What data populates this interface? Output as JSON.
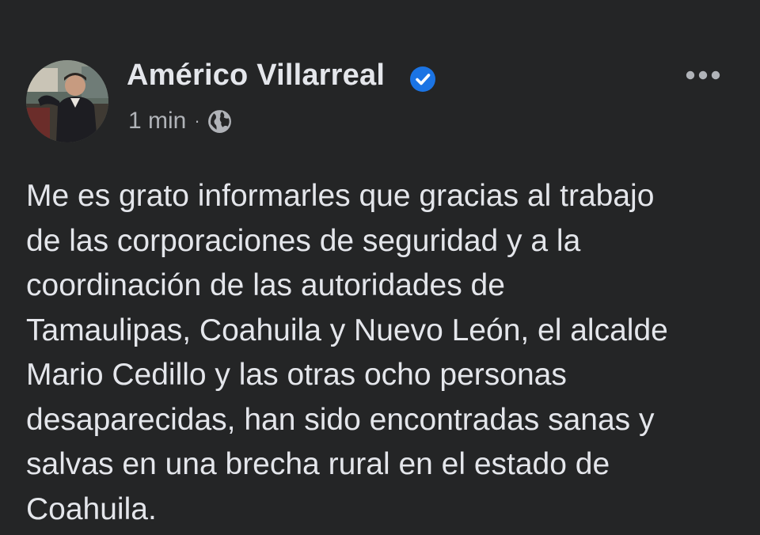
{
  "post": {
    "author": {
      "name": "Américo Villarreal",
      "verified": true,
      "avatar_icon": "person-portrait"
    },
    "timestamp": "1 min",
    "separator": "·",
    "audience_icon": "globe-icon",
    "menu_icon": "more-options-icon",
    "text_lines": [
      "Me es grato informarles que gracias al trabajo",
      "de las corporaciones de seguridad y a la",
      "coordinación de las autoridades de",
      "Tamaulipas, Coahuila y Nuevo León, el alcalde",
      "Mario Cedillo y las otras ocho personas",
      "desaparecidas, han sido encontradas sanas y",
      "salvas en una brecha rural en el estado de",
      "Coahuila."
    ]
  },
  "colors": {
    "background": "#242526",
    "primary_text": "#e4e6eb",
    "secondary_text": "#b0b3b8",
    "verified_badge": "#1b74e4"
  }
}
